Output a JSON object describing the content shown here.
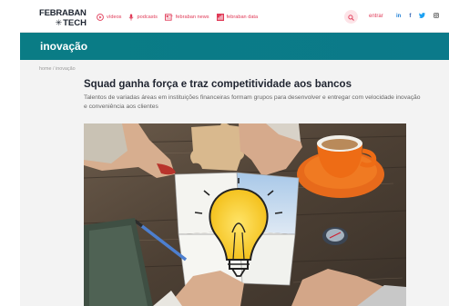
{
  "header": {
    "logo_top": "FEBRABAN",
    "logo_bottom": "TECH",
    "nav": [
      {
        "label": "vídeos",
        "icon": "play-icon"
      },
      {
        "label": "podcasts",
        "icon": "microphone-icon"
      },
      {
        "label": "febraban news",
        "icon": "news-icon"
      },
      {
        "label": "febraban data",
        "icon": "data-icon"
      }
    ],
    "login_label": "entrar",
    "social": [
      {
        "label": "in",
        "icon": "linkedin-icon"
      },
      {
        "label": "f",
        "icon": "facebook-icon"
      },
      {
        "label": "t",
        "icon": "twitter-icon"
      },
      {
        "label": "ig",
        "icon": "instagram-icon"
      }
    ]
  },
  "section": {
    "title": "inovação"
  },
  "breadcrumb": {
    "home": "home",
    "separator": "/",
    "current": "inovação"
  },
  "article": {
    "title": "Squad ganha força e traz competitividade aos bancos",
    "subtitle": "Talentos de variadas áreas em instituições financeiras formam grupos para desenvolver e entregar com velocidade inovação e conveniência aos clientes"
  },
  "colors": {
    "accent": "#e03a57",
    "banner": "#0a7c85",
    "text": "#1f2430"
  }
}
